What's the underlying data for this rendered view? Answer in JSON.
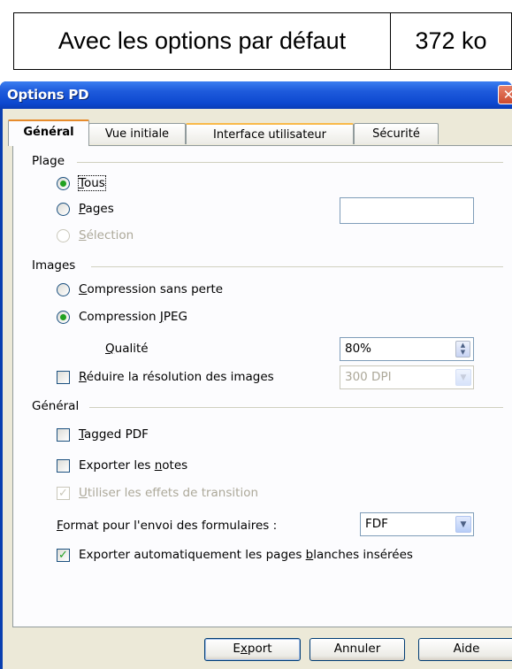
{
  "top_table": {
    "label": "Avec les options par défaut",
    "size": "372 ko"
  },
  "dialog": {
    "title": "Options PD",
    "close_icon": "close-icon"
  },
  "tabs": [
    {
      "label": "Général",
      "active": true
    },
    {
      "label": "Vue initiale",
      "active": false
    },
    {
      "label": "Interface utilisateur",
      "active": false
    },
    {
      "label": "Sécurité",
      "active": false
    }
  ],
  "plage": {
    "title": "Plage",
    "tous_u": "T",
    "tous_rest": "ous",
    "pages_u": "P",
    "pages_rest": "ages",
    "pages_value": "",
    "selection_u": "S",
    "selection_rest": "élection",
    "selected": "Tous"
  },
  "images": {
    "title": "Images",
    "lossless_u": "C",
    "lossless_rest": "ompression sans perte",
    "jpeg_pre": "Compression ",
    "jpeg_u": "J",
    "jpeg_rest": "PEG",
    "quality_u": "Q",
    "quality_rest": "ualité",
    "quality_value": "80%",
    "reduce_u": "R",
    "reduce_rest": "éduire la résolution des images",
    "resolution_value": "300 DPI",
    "selected": "Compression JPEG"
  },
  "general": {
    "title": "Général",
    "tagged_u": "T",
    "tagged_rest": "agged PDF",
    "notes_pre": "Exporter les ",
    "notes_u": "n",
    "notes_rest": "otes",
    "transition_u": "U",
    "transition_rest": "tiliser les effets de transition",
    "format_u": "F",
    "format_rest": "ormat pour l'envoi des formulaires :",
    "format_value": "FDF",
    "blank_pre": "Exporter automatiquement les pages ",
    "blank_u": "b",
    "blank_rest": "lanches insérées",
    "tagged_checked": false,
    "notes_checked": false,
    "transition_checked": true,
    "blank_checked": true
  },
  "buttons": {
    "export_pre": "E",
    "export_u": "x",
    "export_rest": "port",
    "cancel": "Annuler",
    "help": "Aide"
  },
  "colors": {
    "titlebar": "#0d48cf",
    "tab_highlight": "#e68b2c",
    "check_green": "#21a121"
  }
}
